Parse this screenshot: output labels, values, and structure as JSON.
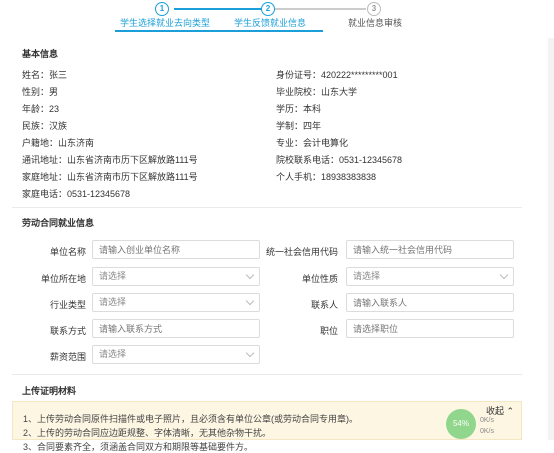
{
  "stepper": {
    "steps": [
      {
        "num": "1",
        "label": "学生选择就业去向类型"
      },
      {
        "num": "2",
        "label": "学生反馈就业信息"
      },
      {
        "num": "3",
        "label": "就业信息审核"
      }
    ],
    "colors": {
      "active": "#1a9fd9",
      "inactive": "#bbbbbb"
    }
  },
  "basic": {
    "title": "基本信息",
    "left": [
      "姓名：张三",
      "性别：男",
      "年龄：23",
      "民族：汉族",
      "户籍地：山东济南",
      "通讯地址：山东省济南市历下区解放路111号",
      "家庭地址：山东省济南市历下区解放路111号",
      "家庭电话：0531-12345678"
    ],
    "right": [
      "身份证号：420222*********001",
      "毕业院校：山东大学",
      "学历：本科",
      "学制：四年",
      "专业：会计电算化",
      "院校联系电话：0531-12345678",
      "个人手机：18938383838"
    ]
  },
  "contract": {
    "title": "劳动合同就业信息",
    "fields": {
      "company_name": {
        "label": "单位名称",
        "placeholder": "请输入创业单位名称"
      },
      "credit_code": {
        "label": "统一社会信用代码",
        "placeholder": "请输入统一社会信用代码"
      },
      "location": {
        "label": "单位所在地",
        "value": "请选择"
      },
      "nature": {
        "label": "单位性质",
        "value": "请选择"
      },
      "industry": {
        "label": "行业类型",
        "value": "请选择"
      },
      "contact": {
        "label": "联系人",
        "placeholder": "请输入联系人"
      },
      "contact_method": {
        "label": "联系方式",
        "placeholder": "请输入联系方式"
      },
      "position": {
        "label": "职位",
        "placeholder": "请选择职位"
      },
      "salary": {
        "label": "薪资范围",
        "value": "请选择"
      }
    }
  },
  "upload": {
    "title": "上传证明材料",
    "notes": [
      "1、上传劳动合同原件扫描件或电子照片，且必须含有单位公章(或劳动合同专用章)。",
      "2、上传的劳动合同应边距规整、字体清晰，无其他杂物干扰。",
      "3、合同要素齐全，须涵盖合同双方和期限等基础要件方。"
    ],
    "collapse_label": "收起",
    "speed_label": "54%",
    "speed_up": "0K/s",
    "speed_down": "0K/s"
  }
}
